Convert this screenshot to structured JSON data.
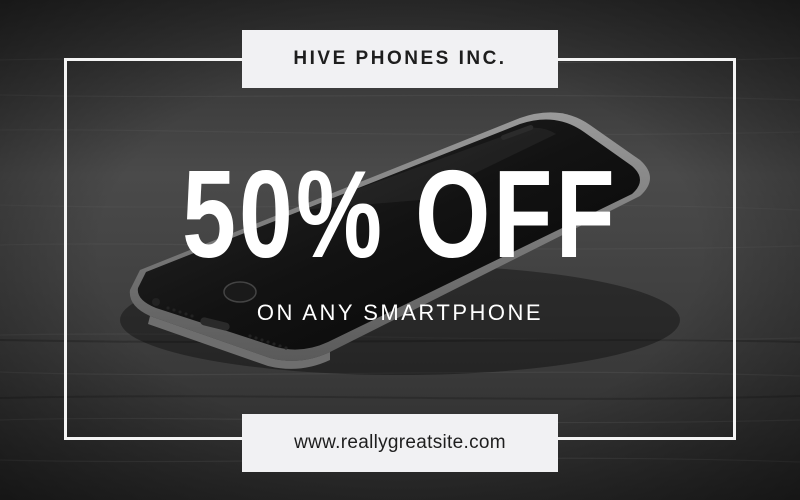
{
  "brand": {
    "name": "HIVE PHONES INC."
  },
  "promo": {
    "headline": "50% OFF",
    "subline": "ON ANY SMARTPHONE"
  },
  "footer": {
    "url": "www.reallygreatsite.com"
  },
  "colors": {
    "background": "#3a3a3a",
    "frame": "#f4f4f4",
    "label_box": "#f1f1f3",
    "label_text": "#1e1e1e",
    "headline_text": "#ffffff"
  },
  "icons": {
    "photo": "smartphone-photo"
  }
}
